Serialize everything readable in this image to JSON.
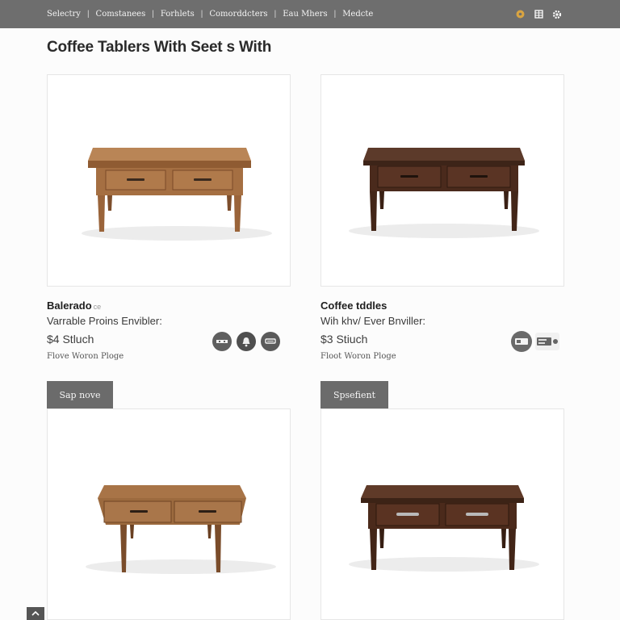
{
  "nav": {
    "items": [
      "Selectry",
      "Comstanees",
      "Forhlets",
      "Comorddcters",
      "Eau Mhers",
      "Medcte"
    ],
    "icons": [
      "info-icon",
      "grid-icon",
      "settings-icon"
    ]
  },
  "page": {
    "title": "Coffee Tablers With Seet s With"
  },
  "products": [
    {
      "name": "Balerado",
      "tag": "ce",
      "subtitle": "Varrable Proins Envibler:",
      "price": "$4 Stluch",
      "shipping": "Flove Woron Ploge",
      "style": "light-oak"
    },
    {
      "name": "Coffee tddles",
      "tag": "",
      "subtitle": "Wih khv/ Ever Bnviller:",
      "price": "$3 Stiuch",
      "shipping": "Floot Woron Ploge",
      "style": "dark-walnut"
    },
    {
      "style": "light-oak-tapered"
    },
    {
      "style": "dark-walnut-pulls"
    }
  ],
  "actions": {
    "left_button_label": "Sap nove",
    "right_button_label": "Spsefient"
  },
  "icons": {
    "left_row": [
      "compare-icon",
      "bell-icon",
      "cart-icon"
    ],
    "right_row": [
      "info-chip-icon",
      "tag-icon"
    ]
  },
  "colors": {
    "topbar": "#6e6e6e",
    "button": "#6b6b6b",
    "oak": "#a06a3d",
    "walnut": "#4e2c1e"
  }
}
